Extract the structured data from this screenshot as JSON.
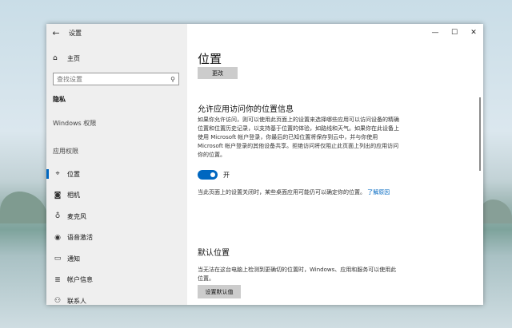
{
  "window": {
    "title": "设置"
  },
  "sidebar": {
    "home": "主页",
    "search_placeholder": "查找设置",
    "section_privacy": "隐私",
    "section_windows": "Windows 权限",
    "section_apps": "应用权限",
    "items": [
      {
        "label": "位置",
        "icon": "location-icon",
        "active": true
      },
      {
        "label": "相机",
        "icon": "camera-icon"
      },
      {
        "label": "麦克风",
        "icon": "microphone-icon"
      },
      {
        "label": "语音激活",
        "icon": "voice-icon"
      },
      {
        "label": "通知",
        "icon": "notification-icon"
      },
      {
        "label": "帐户信息",
        "icon": "account-info-icon"
      },
      {
        "label": "联系人",
        "icon": "contacts-icon"
      }
    ]
  },
  "main": {
    "title": "位置",
    "change_button": "更改",
    "allow_heading": "允许应用访问你的位置信息",
    "allow_description": "如果你允许访问，则可以使用此页面上的设置来选择哪些应用可以访问设备的精确位置和位置历史记录，以支持基于位置的体验，如路线和天气。如果你在此设备上使用 Microsoft 帐户登录，你最后的已知位置将保存到云中，并与你使用 Microsoft 帐户登录的其他设备共享。拒绝访问将仅阻止此页面上列出的应用访问你的位置。",
    "toggle_state": "开",
    "toggle_on": true,
    "off_note": "当此页面上的设置关闭时，某些桌面应用可能仍可以确定你的位置。",
    "learn_more": "了解原因",
    "default_heading": "默认位置",
    "default_description": "当无法在这台电脑上检测到更确切的位置时，Windows、应用和服务可以使用此位置。",
    "set_default_button": "设置默认值"
  },
  "colors": {
    "accent": "#0067c0",
    "sidebar_bg": "#efefef"
  }
}
